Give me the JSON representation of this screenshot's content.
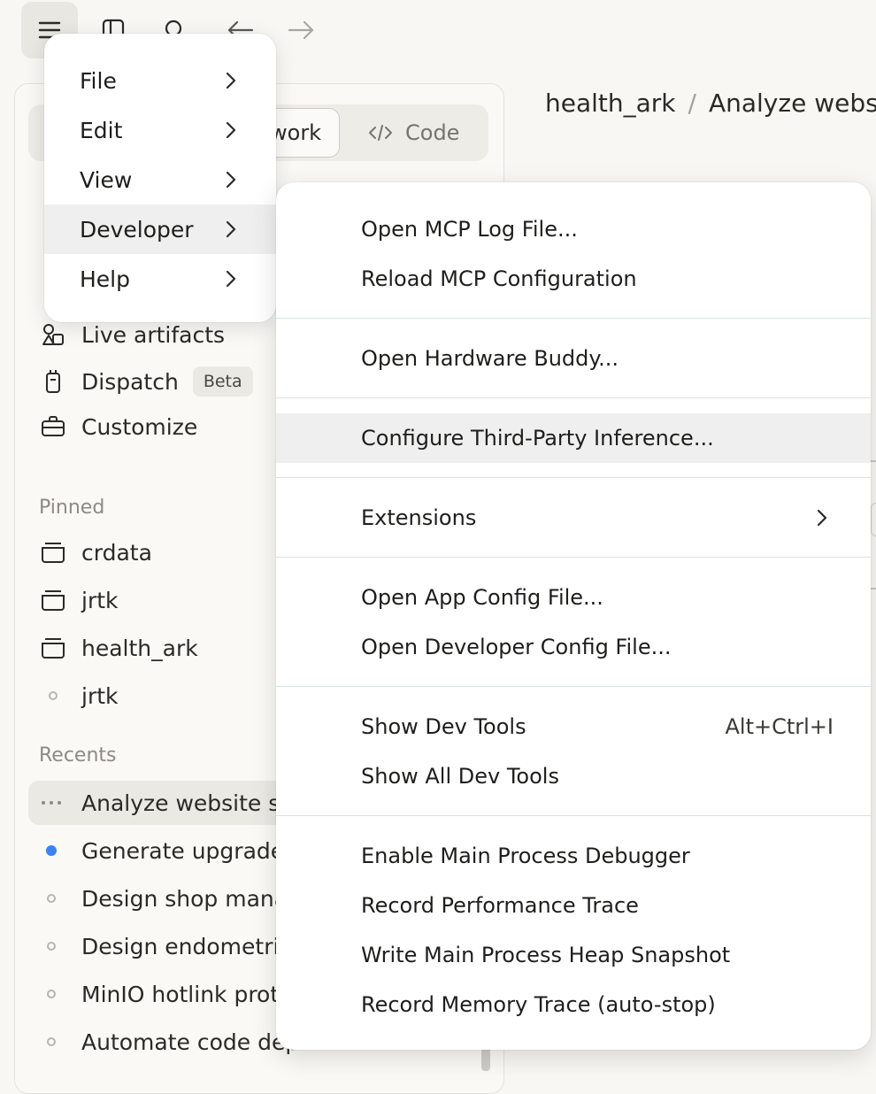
{
  "toolbar": {
    "icons": [
      "menu-icon",
      "sidebar-toggle-icon",
      "search-icon",
      "back-arrow-icon",
      "forward-arrow-icon"
    ]
  },
  "mode_toggle": {
    "work_label": "work",
    "code_label": "Code"
  },
  "nav": [
    {
      "label": "Live artifacts",
      "icon": "artifacts-icon"
    },
    {
      "label": "Dispatch",
      "icon": "dispatch-icon",
      "badge": "Beta"
    },
    {
      "label": "Customize",
      "icon": "briefcase-icon"
    }
  ],
  "pinned": {
    "title": "Pinned",
    "items": [
      {
        "label": "crdata",
        "icon": "project-icon"
      },
      {
        "label": "jrtk",
        "icon": "project-icon"
      },
      {
        "label": "health_ark",
        "icon": "project-icon"
      },
      {
        "label": "jrtk",
        "icon": "hollow-dot-icon"
      }
    ]
  },
  "recents": {
    "title": "Recents",
    "items": [
      {
        "label": "Analyze website st",
        "indicator": "more-dots",
        "active": true
      },
      {
        "label": "Generate upgrade",
        "indicator": "blue-dot"
      },
      {
        "label": "Design shop mana",
        "indicator": "hollow-dot"
      },
      {
        "label": "Design endometri",
        "indicator": "hollow-dot"
      },
      {
        "label": "MinIO hotlink prot",
        "indicator": "hollow-dot"
      },
      {
        "label": "Automate code dep",
        "indicator": "hollow-dot"
      }
    ]
  },
  "breadcrumb": {
    "project": "health_ark",
    "separator": "/",
    "current": "Analyze websit"
  },
  "app_menu": {
    "items": [
      {
        "label": "File"
      },
      {
        "label": "Edit"
      },
      {
        "label": "View"
      },
      {
        "label": "Developer",
        "highlighted": true
      },
      {
        "label": "Help"
      }
    ]
  },
  "developer_menu": {
    "items": [
      {
        "label": "Open MCP Log File..."
      },
      {
        "label": "Reload MCP Configuration"
      },
      {
        "label": "Open Hardware Buddy..."
      },
      {
        "label": "Configure Third-Party Inference...",
        "highlighted": true
      },
      {
        "label": "Extensions",
        "submenu": true
      },
      {
        "label": "Open App Config File..."
      },
      {
        "label": "Open Developer Config File..."
      },
      {
        "label": "Show Dev Tools",
        "shortcut": "Alt+Ctrl+I"
      },
      {
        "label": "Show All Dev Tools"
      },
      {
        "label": "Enable Main Process Debugger"
      },
      {
        "label": "Record Performance Trace"
      },
      {
        "label": "Write Main Process Heap Snapshot"
      },
      {
        "label": "Record Memory Trace (auto-stop)"
      }
    ]
  },
  "colors": {
    "background": "#f8f7f4",
    "menu_bg": "#ffffff",
    "highlight": "#efefef",
    "accent_blue": "#3b82f6",
    "separator": "#d6e4e2"
  }
}
